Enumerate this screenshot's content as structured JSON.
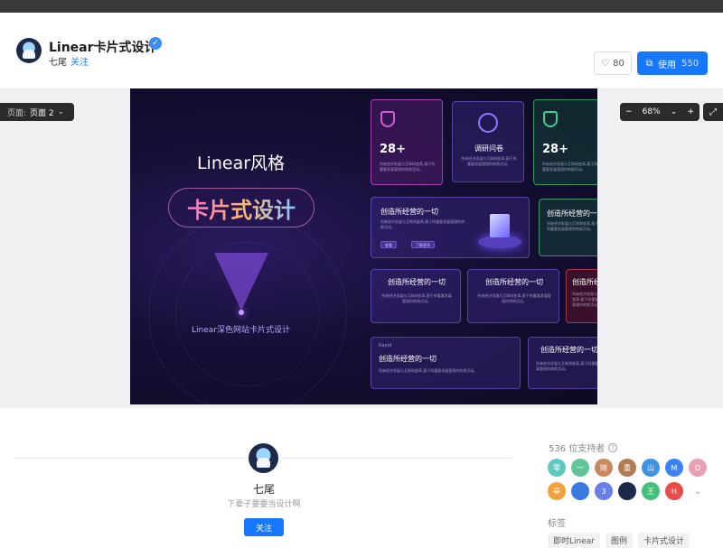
{
  "header": {
    "title": "Linear卡片式设计",
    "author": "七尾",
    "follow_link": "关注",
    "likes": "80",
    "use_label": "使用",
    "use_count": "550"
  },
  "canvas": {
    "page_label": "页面:",
    "page_value": "页面 2",
    "zoom": "68%"
  },
  "design": {
    "heading": "Linear风格",
    "pill": "卡片式设计",
    "subtitle": "Linear深色网站卡片式设计",
    "stat": "28+",
    "survey": "调研问卷",
    "slogan": "创造所经营的一切",
    "tag_small": "Rapid",
    "chip_a": "查看",
    "chip_b": "了解更多",
    "body_text": "所来经济发展与互联网变革,基于所重要发展管理的转换活动。"
  },
  "profile": {
    "name": "七尾",
    "bio": "下辈子要要当设计啊",
    "follow": "关注"
  },
  "sidebar": {
    "supporters": "536 位支持者",
    "avatars": [
      {
        "label": "零",
        "color": "#5fc9c0"
      },
      {
        "label": "一",
        "color": "#62c597"
      },
      {
        "label": "随",
        "color": "#c9885e"
      },
      {
        "label": "重",
        "color": "#b07d53"
      },
      {
        "label": "山",
        "color": "#3f93e0"
      },
      {
        "label": "M",
        "color": "#3b82f6"
      },
      {
        "label": "D",
        "color": "#e9a0b3"
      },
      {
        "label": "旱",
        "color": "#f0a23c"
      },
      {
        "label": "",
        "color": "#3a7be0"
      },
      {
        "label": "3",
        "color": "#6a7fe6"
      },
      {
        "label": "",
        "color": "#1c2a4a"
      },
      {
        "label": "王",
        "color": "#45c07a"
      },
      {
        "label": "H",
        "color": "#ea4b4b"
      }
    ],
    "tags_label": "标签",
    "tags": [
      "即时Linear",
      "图例",
      "卡片式设计"
    ]
  }
}
